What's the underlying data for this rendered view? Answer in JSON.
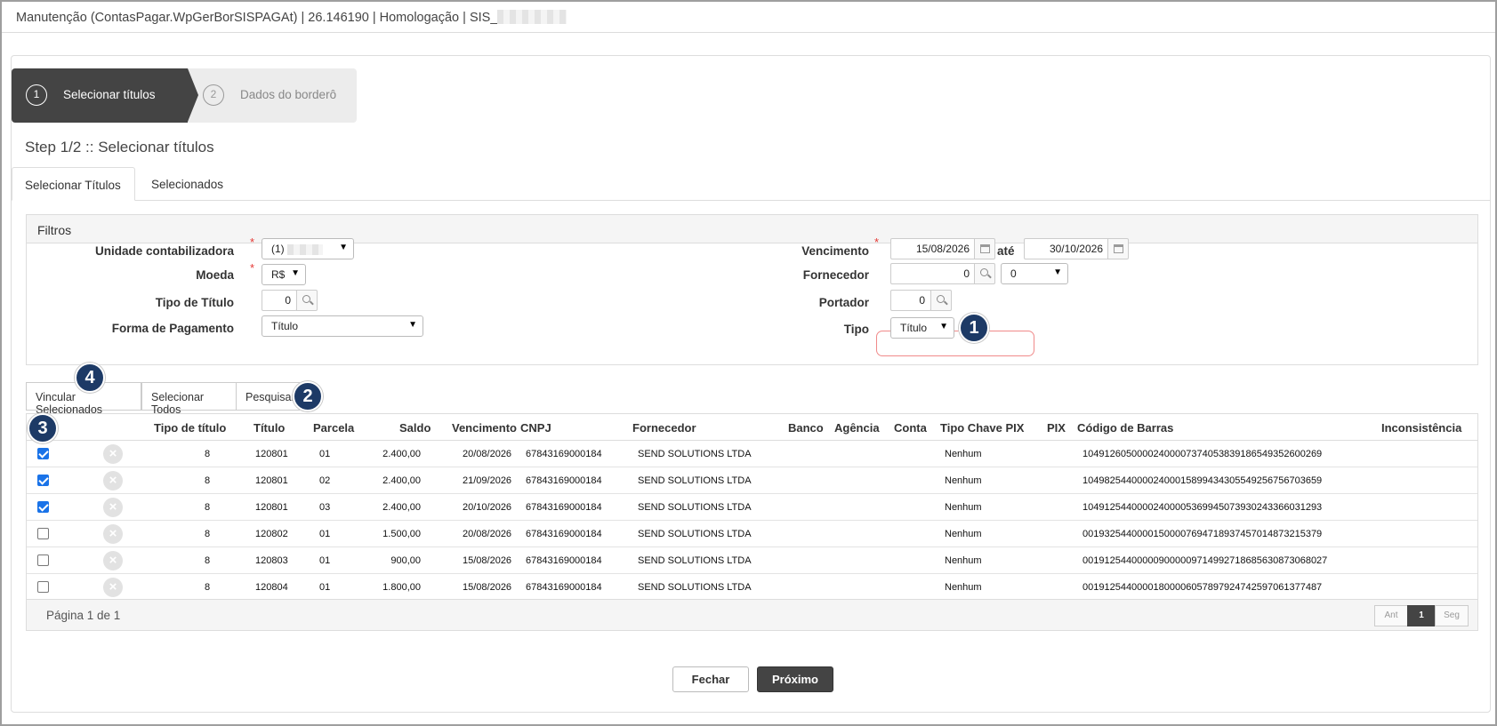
{
  "window": {
    "title": "Manutenção (ContasPagar.WpGerBorSISPAGAt) | 26.146190 | Homologação | SIS_"
  },
  "stepper": {
    "steps": [
      {
        "num": "1",
        "label": "Selecionar títulos"
      },
      {
        "num": "2",
        "label": "Dados do borderô"
      }
    ]
  },
  "step_title": "Step 1/2 :: Selecionar títulos",
  "tabs": [
    "Selecionar Títulos",
    "Selecionados"
  ],
  "filters": {
    "header": "Filtros",
    "unidade_label": "Unidade contabilizadora",
    "unidade_value": "(1)",
    "moeda_label": "Moeda",
    "moeda_value": "R$",
    "tipo_titulo_label": "Tipo de Título",
    "tipo_titulo_value": "0",
    "forma_pag_label": "Forma de Pagamento",
    "forma_pag_value": "Título",
    "vencimento_label": "Vencimento",
    "vencimento_de": "15/08/2026",
    "ate_label": "até",
    "vencimento_ate": "30/10/2026",
    "fornecedor_label": "Fornecedor",
    "fornecedor_value": "0",
    "fornecedor_select": "0",
    "portador_label": "Portador",
    "portador_value": "0",
    "tipo_label": "Tipo",
    "tipo_value": "Título",
    "required_mark": "*"
  },
  "actions": [
    "Vincular Selecionados",
    "Selecionar Todos",
    "Pesquisar"
  ],
  "badges": [
    "1",
    "2",
    "3",
    "4"
  ],
  "grid": {
    "columns": [
      "Tipo de título",
      "Título",
      "Parcela",
      "Saldo",
      "Vencimento",
      "CNPJ",
      "Fornecedor",
      "Banco",
      "Agência",
      "Conta",
      "Tipo Chave PIX",
      "PIX",
      "Código de Barras",
      "Inconsistência"
    ],
    "rows": [
      {
        "checked": true,
        "tipo": "8",
        "titulo": "120801",
        "parcela": "01",
        "saldo": "2.400,00",
        "vencimento": "20/08/2026",
        "cnpj": "67843169000184",
        "fornecedor": "SEND SOLUTIONS LTDA",
        "tipo_pix": "Nenhum",
        "codigo": "10491260500002400007374053839186549352600269"
      },
      {
        "checked": true,
        "tipo": "8",
        "titulo": "120801",
        "parcela": "02",
        "saldo": "2.400,00",
        "vencimento": "21/09/2026",
        "cnpj": "67843169000184",
        "fornecedor": "SEND SOLUTIONS LTDA",
        "tipo_pix": "Nenhum",
        "codigo": "10498254400002400015899434305549256756703659"
      },
      {
        "checked": true,
        "tipo": "8",
        "titulo": "120801",
        "parcela": "03",
        "saldo": "2.400,00",
        "vencimento": "20/10/2026",
        "cnpj": "67843169000184",
        "fornecedor": "SEND SOLUTIONS LTDA",
        "tipo_pix": "Nenhum",
        "codigo": "10491254400002400005369945073930243366031293"
      },
      {
        "checked": false,
        "tipo": "8",
        "titulo": "120802",
        "parcela": "01",
        "saldo": "1.500,00",
        "vencimento": "20/08/2026",
        "cnpj": "67843169000184",
        "fornecedor": "SEND SOLUTIONS LTDA",
        "tipo_pix": "Nenhum",
        "codigo": "00193254400001500007694718937457014873215379"
      },
      {
        "checked": false,
        "tipo": "8",
        "titulo": "120803",
        "parcela": "01",
        "saldo": "900,00",
        "vencimento": "15/08/2026",
        "cnpj": "67843169000184",
        "fornecedor": "SEND SOLUTIONS LTDA",
        "tipo_pix": "Nenhum",
        "codigo": "00191254400000900000971499271868563087306802​7"
      },
      {
        "checked": false,
        "tipo": "8",
        "titulo": "120804",
        "parcela": "01",
        "saldo": "1.800,00",
        "vencimento": "15/08/2026",
        "cnpj": "67843169000184",
        "fornecedor": "SEND SOLUTIONS LTDA",
        "tipo_pix": "Nenhum",
        "codigo": "00191254400001800006057897924742597061377487"
      }
    ],
    "pagination": {
      "info": "Página 1 de 1",
      "prev": "Ant",
      "current": "1",
      "next": "Seg"
    }
  },
  "footer": {
    "close": "Fechar",
    "next": "Próximo"
  }
}
